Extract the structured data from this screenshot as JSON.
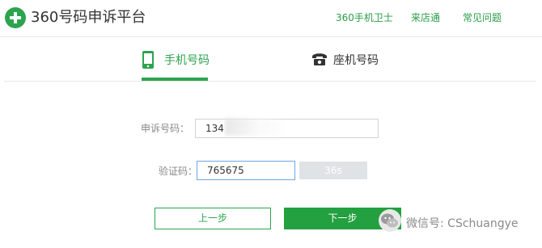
{
  "header": {
    "brand": "360号码申诉平台",
    "nav": [
      "360手机卫士",
      "来店通",
      "常见问题"
    ]
  },
  "tabs": {
    "mobile": "手机号码",
    "landline": "座机号码"
  },
  "form": {
    "phone_label": "申诉号码：",
    "phone_value": "134",
    "code_label": "验证码：",
    "code_value": "765675",
    "countdown": "36s"
  },
  "buttons": {
    "prev": "上一步",
    "next": "下一步"
  },
  "watermark": "微信号: CSchuangye",
  "colors": {
    "accent": "#2ca44f",
    "primary_button": "#23a03f",
    "focus_border": "#6ea5e6",
    "countdown_bg": "#dfe3e6"
  }
}
